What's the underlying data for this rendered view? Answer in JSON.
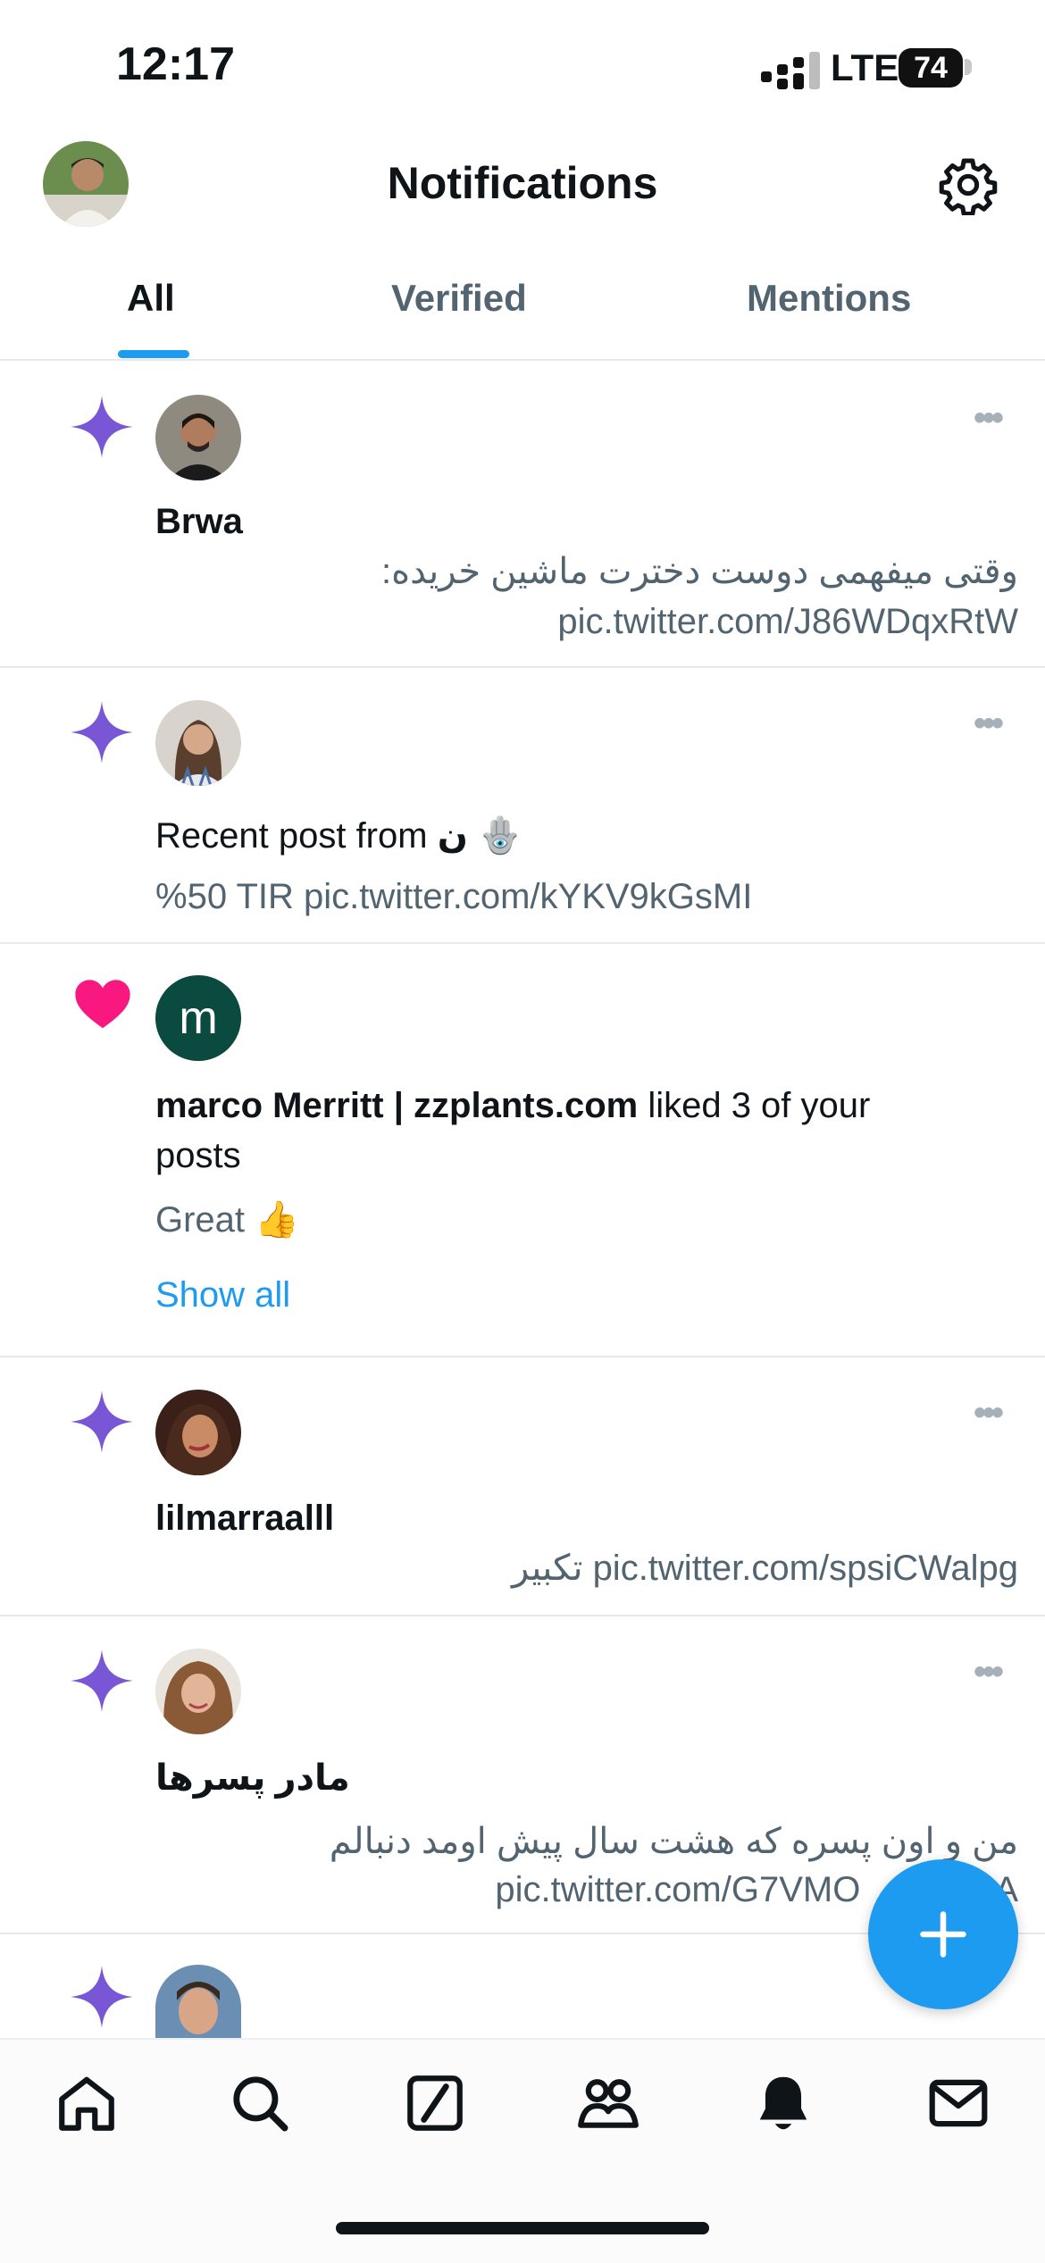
{
  "status": {
    "time": "12:17",
    "network": "LTE",
    "battery": "74"
  },
  "header": {
    "title": "Notifications"
  },
  "tabs": [
    {
      "label": "All",
      "active": true
    },
    {
      "label": "Verified",
      "active": false
    },
    {
      "label": "Mentions",
      "active": false
    }
  ],
  "notifications": [
    {
      "type": "recommendation",
      "icon": "sparkle-icon",
      "name": "Brwa",
      "text_line1": "وقتی میفهمی دوست دخترت ماشین خریده:",
      "text_line2": "pic.twitter.com/J86WDqxRtW"
    },
    {
      "type": "recent-post",
      "icon": "sparkle-icon",
      "prefix": "Recent post from",
      "name": "ن",
      "emoji": "🪬",
      "text": "%50 TIR pic.twitter.com/kYKV9kGsMI"
    },
    {
      "type": "like",
      "icon": "heart-icon",
      "avatar_letter": "m",
      "name": "marco Merritt | zzplants.com",
      "action": " liked 3 of your",
      "action_line2": "posts",
      "text": "Great",
      "emoji": "👍",
      "show_all": "Show all"
    },
    {
      "type": "recommendation",
      "icon": "sparkle-icon",
      "name": "lilmarraalll",
      "text_line1": "pic.twitter.com/spsiCWalpg تکبیر"
    },
    {
      "type": "recommendation",
      "icon": "sparkle-icon",
      "name": "مادر پسرها",
      "text_line1": "من و اون پسره که هشت سال پیش اومد دنبالم",
      "text_line2": "pic.twitter.com/G7VMO",
      "text_line2_tail": "A"
    },
    {
      "type": "recommendation",
      "icon": "sparkle-icon"
    }
  ],
  "colors": {
    "accent": "#1d9bf0",
    "sparkle": "#7856d6",
    "heart": "#f91880",
    "muted": "#536471"
  },
  "nav": [
    "home-icon",
    "search-icon",
    "compose-square-icon",
    "communities-icon",
    "notifications-bell-icon",
    "messages-icon"
  ]
}
